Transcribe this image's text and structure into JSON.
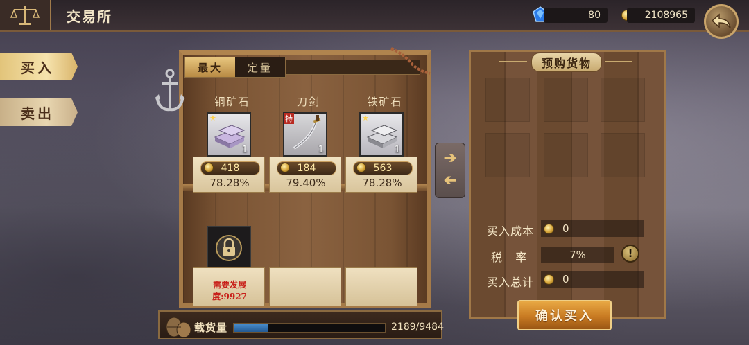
{
  "header": {
    "title": "交易所",
    "gems": "80",
    "gold": "2108965"
  },
  "side_tabs": [
    {
      "label": "买入",
      "active": true
    },
    {
      "label": "卖出",
      "active": false
    }
  ],
  "shelf": {
    "tabs": [
      {
        "label": "最大",
        "active": true
      },
      {
        "label": "定量",
        "active": false
      }
    ],
    "items": [
      {
        "name": "铜矿石",
        "icon": "copper-ingot-icon",
        "qty": "1",
        "star": true,
        "special": "",
        "price": "418",
        "percent": "78.28%"
      },
      {
        "name": "刀剑",
        "icon": "saber-icon",
        "qty": "1",
        "star": false,
        "special": "特",
        "price": "184",
        "percent": "79.40%"
      },
      {
        "name": "铁矿石",
        "icon": "iron-ingot-icon",
        "qty": "1",
        "star": true,
        "special": "",
        "price": "563",
        "percent": "78.28%"
      }
    ],
    "locked_slot": {
      "requirement_line1": "需要发展",
      "requirement_line2": "度:9927"
    }
  },
  "capacity": {
    "label": "载货量",
    "current": 2189,
    "max": 9484,
    "text": "2189/9484"
  },
  "purchase_panel": {
    "title": "预购货物",
    "cost_label": "买入成本",
    "cost_value": "0",
    "tax_label": "税   率",
    "tax_value": "7%",
    "total_label": "买入总计",
    "total_value": "0",
    "confirm_label": "确认买入"
  },
  "colors": {
    "accent_gold": "#e8a844",
    "requirement_red": "#c8201a",
    "capacity_blue": "#4a8fd0"
  }
}
